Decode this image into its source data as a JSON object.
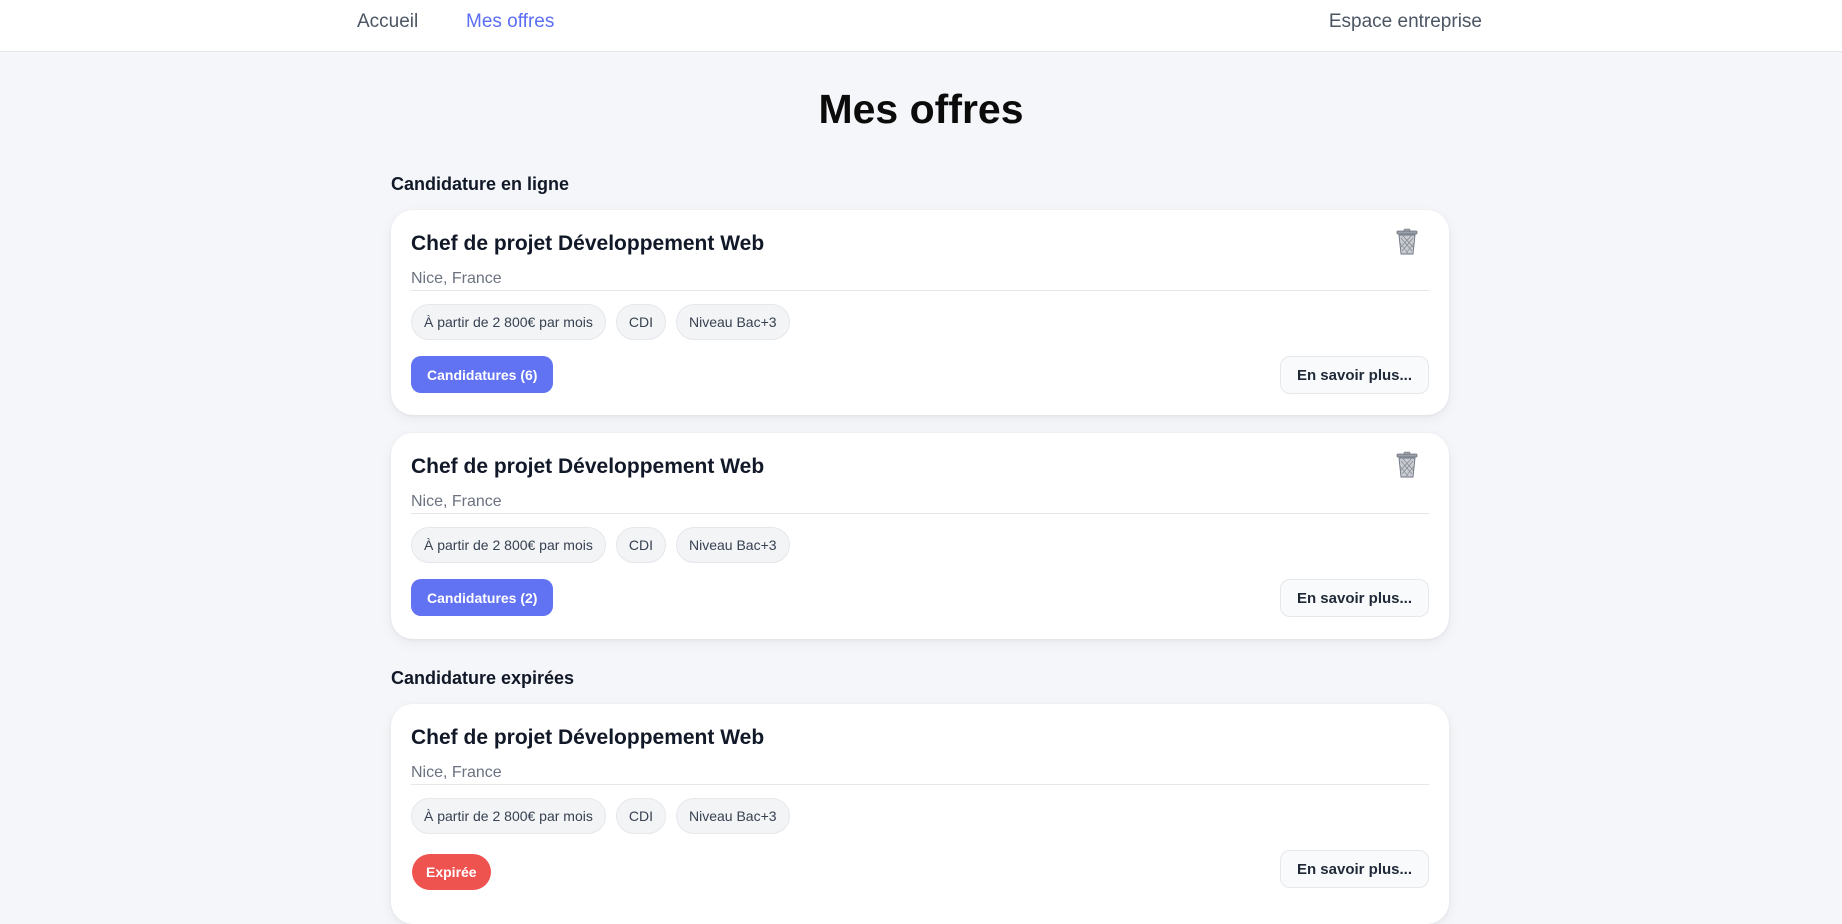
{
  "nav": {
    "home": "Accueil",
    "offers": "Mes offres",
    "company": "Espace entreprise"
  },
  "page": {
    "title": "Mes offres"
  },
  "sections": {
    "online": "Candidature en ligne",
    "expired": "Candidature expirées"
  },
  "offers": [
    {
      "title": "Chef de projet Développement Web",
      "location": "Nice, France",
      "tags": [
        "À partir de 2 800€ par mois",
        "CDI",
        "Niveau Bac+3"
      ],
      "applications_label": "Candidatures (6)",
      "more_label": "En savoir plus...",
      "icon": "trash-icon"
    },
    {
      "title": "Chef de projet Développement Web",
      "location": "Nice, France",
      "tags": [
        "À partir de 2 800€ par mois",
        "CDI",
        "Niveau Bac+3"
      ],
      "applications_label": "Candidatures (2)",
      "more_label": "En savoir plus...",
      "icon": "trash-icon"
    }
  ],
  "expired_offers": [
    {
      "title": "Chef de projet Développement Web",
      "location": "Nice, France",
      "tags": [
        "À partir de 2 800€ par mois",
        "CDI",
        "Niveau Bac+3"
      ],
      "status_label": "Expirée",
      "more_label": "En savoir plus..."
    }
  ],
  "colors": {
    "accent": "#6172f3",
    "expired": "#ef5350",
    "background": "#f5f6f9"
  }
}
